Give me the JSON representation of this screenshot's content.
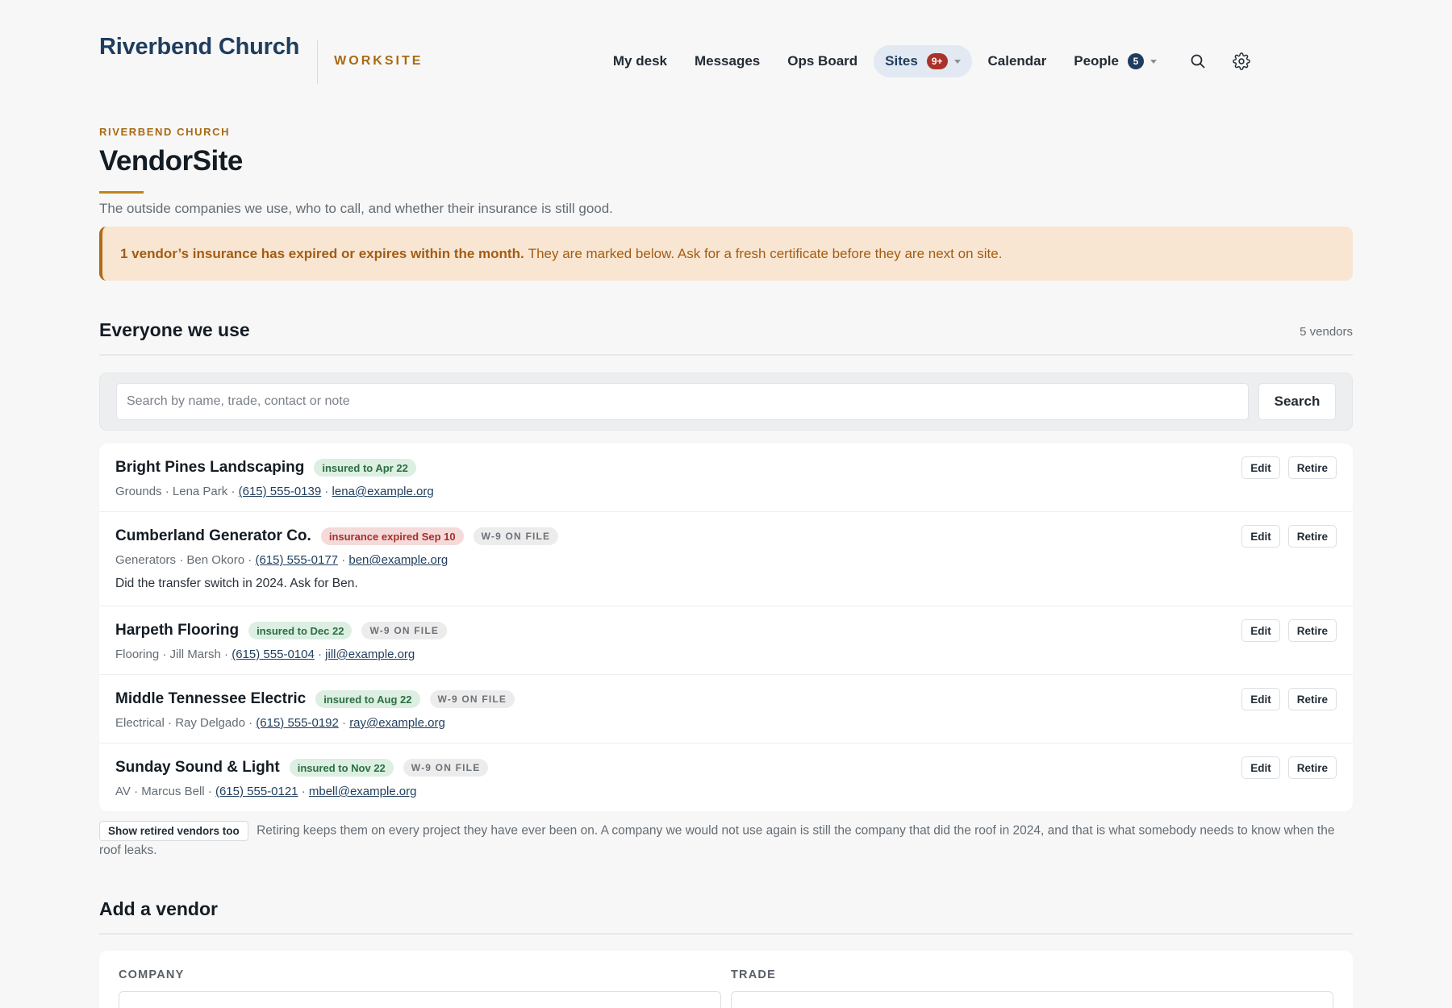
{
  "header": {
    "brand": "Riverbend Church",
    "product": "WORKSITE",
    "nav": [
      {
        "label": "My desk"
      },
      {
        "label": "Messages"
      },
      {
        "label": "Ops Board"
      },
      {
        "label": "Sites",
        "badge": "9+",
        "active": true
      },
      {
        "label": "Calendar"
      },
      {
        "label": "People",
        "badge": "5"
      }
    ],
    "icons": [
      "search-icon",
      "gear-icon"
    ]
  },
  "page": {
    "kicker": "RIVERBEND CHURCH",
    "title": "VendorSite",
    "subtitle": "The outside companies we use, who to call, and whether their insurance is still good."
  },
  "alert": {
    "strong": "1 vendor’s insurance has expired or expires within the month.",
    "text": "They are marked below. Ask for a fresh certificate before they are next on site."
  },
  "list_section": {
    "title": "Everyone we use",
    "count": "5 vendors",
    "search_placeholder": "Search by name, trade, contact or note",
    "search_label": "Search",
    "edit_label": "Edit",
    "retire_label": "Retire"
  },
  "vendors": [
    {
      "name": "Bright Pines Landscaping",
      "insurance": "insured to Apr 22",
      "status": "ok",
      "w9": "",
      "trade": "Grounds",
      "contact": "Lena Park",
      "phone": "(615) 555-0139",
      "email": "lena@example.org",
      "note": ""
    },
    {
      "name": "Cumberland Generator Co.",
      "insurance": "insurance expired Sep 10",
      "status": "bad",
      "w9": "W-9 ON FILE",
      "trade": "Generators",
      "contact": "Ben Okoro",
      "phone": "(615) 555-0177",
      "email": "ben@example.org",
      "note": "Did the transfer switch in 2024. Ask for Ben."
    },
    {
      "name": "Harpeth Flooring",
      "insurance": "insured to Dec 22",
      "status": "ok",
      "w9": "W-9 ON FILE",
      "trade": "Flooring",
      "contact": "Jill Marsh",
      "phone": "(615) 555-0104",
      "email": "jill@example.org",
      "note": ""
    },
    {
      "name": "Middle Tennessee Electric",
      "insurance": "insured to Aug 22",
      "status": "ok",
      "w9": "W-9 ON FILE",
      "trade": "Electrical",
      "contact": "Ray Delgado",
      "phone": "(615) 555-0192",
      "email": "ray@example.org",
      "note": ""
    },
    {
      "name": "Sunday Sound & Light",
      "insurance": "insured to Nov 22",
      "status": "ok",
      "w9": "W-9 ON FILE",
      "trade": "AV",
      "contact": "Marcus Bell",
      "phone": "(615) 555-0121",
      "email": "mbell@example.org",
      "note": ""
    }
  ],
  "retired": {
    "button": "Show retired vendors too",
    "text": "Retiring keeps them on every project they have ever been on. A company we would not use again is still the company that did the roof in 2024, and that is what somebody needs to know when the roof leaks."
  },
  "add_section": {
    "title": "Add a vendor",
    "fields": [
      {
        "label": "COMPANY"
      },
      {
        "label": "TRADE"
      }
    ]
  },
  "colors": {
    "brand_navy": "#1f3d5e",
    "accent_gold": "#a86a12",
    "alert_bg": "#f8e6d3",
    "ok_green": "#2b6e43",
    "bad_red": "#a4302a"
  }
}
